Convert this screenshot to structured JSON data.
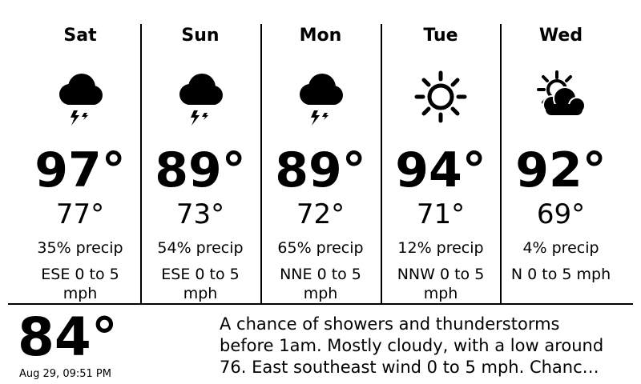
{
  "forecast": [
    {
      "day": "Sat",
      "icon": "thunderstorm-icon",
      "high": "97°",
      "low": "77°",
      "precip": "35% precip",
      "wind": "ESE 0 to 5 mph"
    },
    {
      "day": "Sun",
      "icon": "thunderstorm-icon",
      "high": "89°",
      "low": "73°",
      "precip": "54% precip",
      "wind": "ESE 0 to 5 mph"
    },
    {
      "day": "Mon",
      "icon": "thunderstorm-icon",
      "high": "89°",
      "low": "72°",
      "precip": "65% precip",
      "wind": "NNE 0 to 5 mph"
    },
    {
      "day": "Tue",
      "icon": "sun-icon",
      "high": "94°",
      "low": "71°",
      "precip": "12% precip",
      "wind": "NNW 0 to 5 mph"
    },
    {
      "day": "Wed",
      "icon": "partly-cloudy-icon",
      "high": "92°",
      "low": "69°",
      "precip": "4% precip",
      "wind": "N 0 to 5 mph"
    }
  ],
  "current": {
    "temperature": "84°",
    "timestamp": "Aug 29, 09:51 PM",
    "summary": "A chance of showers and thunderstorms\nbefore 1am. Mostly cloudy, with a low around\n76. East southeast wind 0 to 5 mph. Chanc…"
  }
}
